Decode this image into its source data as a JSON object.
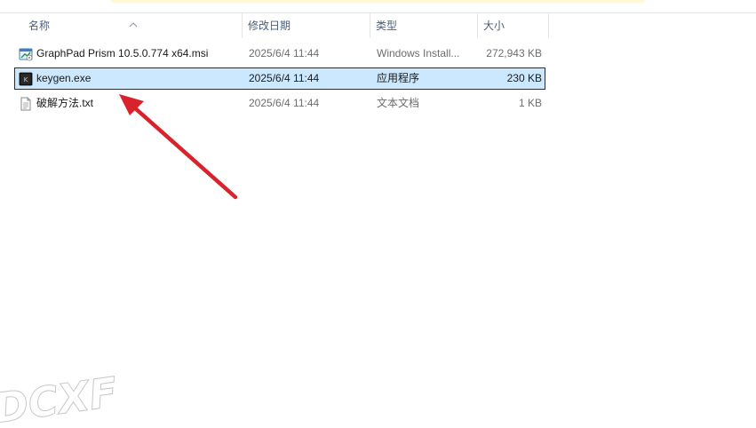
{
  "columns": {
    "name": "名称",
    "date": "修改日期",
    "type": "类型",
    "size": "大小"
  },
  "files": [
    {
      "name": "GraphPad Prism 10.5.0.774 x64.msi",
      "date": "2025/6/4 11:44",
      "type": "Windows Install...",
      "size": "272,943 KB",
      "icon": "msi-installer-icon",
      "selected": false
    },
    {
      "name": "keygen.exe",
      "date": "2025/6/4 11:44",
      "type": "应用程序",
      "size": "230 KB",
      "icon": "exe-app-icon",
      "selected": true
    },
    {
      "name": "破解方法.txt",
      "date": "2025/6/4 11:44",
      "type": "文本文档",
      "size": "1 KB",
      "icon": "text-file-icon",
      "selected": false
    }
  ],
  "colors": {
    "selection": "#cce8ff",
    "arrow": "#d9232c",
    "header_text": "#4c607a"
  },
  "watermark": "DCXF"
}
